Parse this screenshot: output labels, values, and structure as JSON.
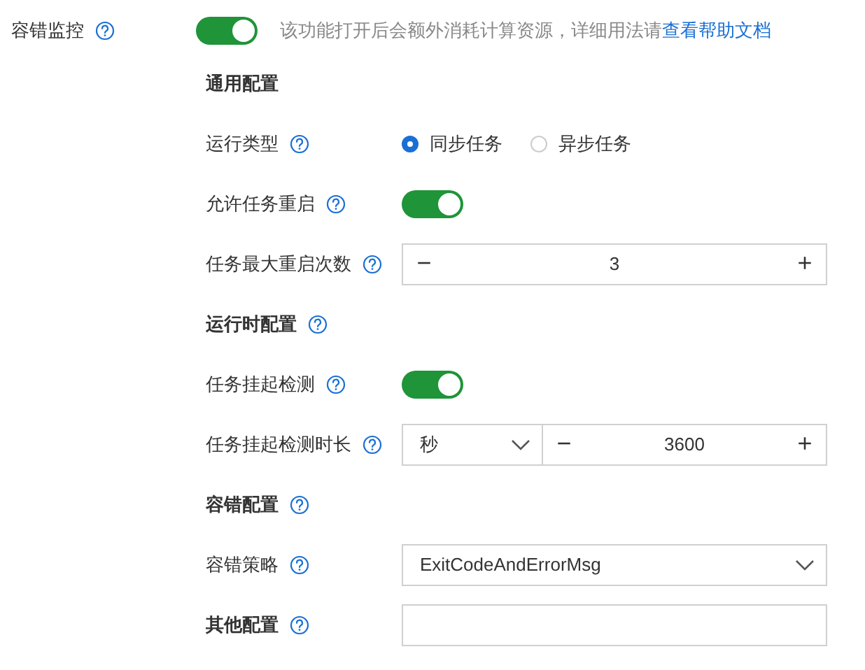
{
  "monitor": {
    "label": "容错监控",
    "on": true,
    "description": "该功能打开后会额外消耗计算资源，详细用法请",
    "link": "查看帮助文档"
  },
  "rows": [
    {
      "kind": "section",
      "label": "通用配置",
      "help": false
    },
    {
      "kind": "radio",
      "label": "运行类型",
      "help": true,
      "options": [
        {
          "label": "同步任务",
          "selected": true
        },
        {
          "label": "异步任务",
          "selected": false
        }
      ]
    },
    {
      "kind": "toggle",
      "label": "允许任务重启",
      "help": true,
      "on": true
    },
    {
      "kind": "stepper",
      "label": "任务最大重启次数",
      "help": true,
      "minus": "−",
      "value": "3",
      "plus": "+"
    },
    {
      "kind": "section",
      "label": "运行时配置",
      "help": true
    },
    {
      "kind": "toggle",
      "label": "任务挂起检测",
      "help": true,
      "on": true
    },
    {
      "kind": "duration",
      "label": "任务挂起检测时长",
      "help": true,
      "unit": "秒",
      "minus": "−",
      "value": "3600",
      "plus": "+"
    },
    {
      "kind": "section",
      "label": "容错配置",
      "help": true
    },
    {
      "kind": "select",
      "label": "容错策略",
      "help": true,
      "value": "ExitCodeAndErrorMsg"
    },
    {
      "kind": "input",
      "label": "其他配置",
      "help": true,
      "bold": true
    }
  ]
}
